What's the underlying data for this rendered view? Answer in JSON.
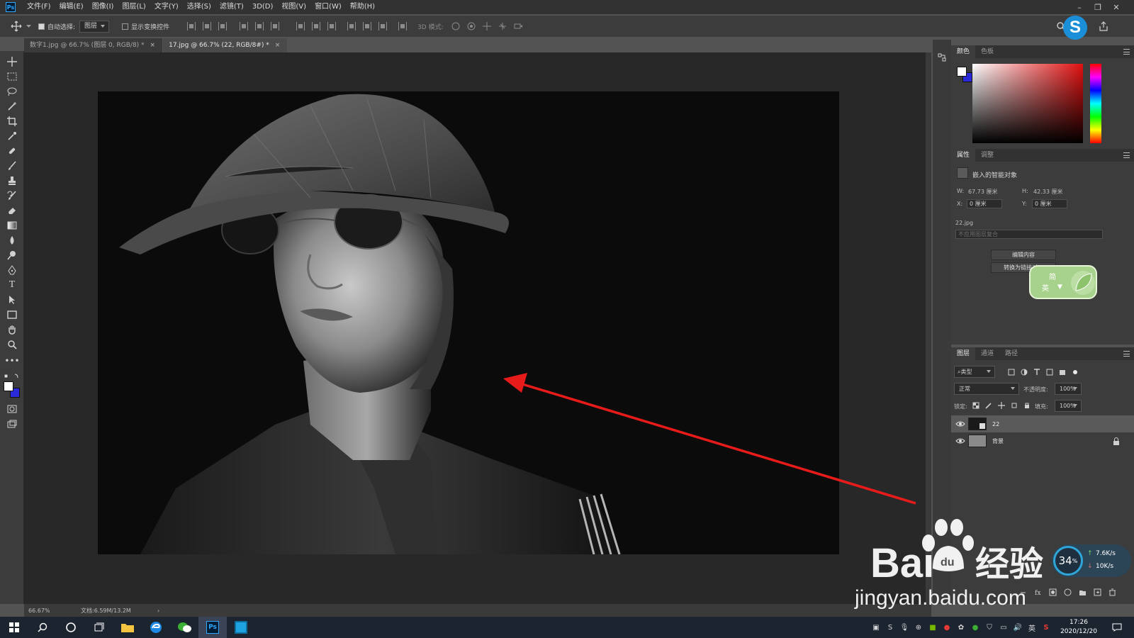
{
  "app": {
    "logo_text": "Ps",
    "menu": [
      "文件(F)",
      "编辑(E)",
      "图像(I)",
      "图层(L)",
      "文字(Y)",
      "选择(S)",
      "滤镜(T)",
      "3D(D)",
      "视图(V)",
      "窗口(W)",
      "帮助(H)"
    ],
    "window_controls": {
      "minimize": "–",
      "restore": "❐",
      "close": "✕"
    }
  },
  "options": {
    "auto_select_label": "自动选择:",
    "auto_select_checked": true,
    "auto_select_target": "图层",
    "show_transform_label": "显示变换控件",
    "show_transform_checked": false,
    "mode_3d_label": "3D 模式:"
  },
  "tabs": [
    {
      "label": "数字1.jpg @ 66.7% (图层 0, RGB/8) *",
      "active": false,
      "close": "×"
    },
    {
      "label": "17.jpg @ 66.7% (22, RGB/8#) *",
      "active": true,
      "close": "×"
    }
  ],
  "status": {
    "zoom": "66.67%",
    "doc_size": "文档:6.59M/13.2M",
    "arrow": "›"
  },
  "color_panel": {
    "tabs": [
      "颜色",
      "色板"
    ],
    "active_tab": "颜色",
    "foreground": "#ffffff",
    "background": "#2a2ad8"
  },
  "properties_panel": {
    "tabs": [
      "属性",
      "调整"
    ],
    "active_tab": "属性",
    "object_type": "嵌入的智能对象",
    "w_label": "W:",
    "w_value": "67.73 厘米",
    "h_label": "H:",
    "h_value": "42.33 厘米",
    "x_label": "X:",
    "x_value": "0 厘米",
    "y_label": "Y:",
    "y_value": "0 厘米",
    "source_file": "22.jpg",
    "layer_comp_placeholder": "不应用图层复合",
    "edit_contents_button": "编辑内容",
    "convert_linked_button": "转换为链接对..."
  },
  "ime_widget": {
    "line1": "简",
    "line2": "英"
  },
  "layers_panel": {
    "tabs": [
      "图层",
      "通道",
      "路径"
    ],
    "active_tab": "图层",
    "filter_kind": "类型",
    "blend_mode": "正常",
    "opacity_label": "不透明度:",
    "opacity_value": "100%",
    "lock_label": "锁定:",
    "fill_label": "填充:",
    "fill_value": "100%",
    "layers": [
      {
        "name": "22",
        "visible": true,
        "selected": true,
        "locked": false
      },
      {
        "name": "背景",
        "visible": true,
        "selected": false,
        "locked": true
      }
    ]
  },
  "network_widget": {
    "percent": "34",
    "unit": "%",
    "upload": "7.6K/s",
    "download": "10K/s"
  },
  "watermark": {
    "brand": "Bai",
    "brand_cn": "经验",
    "url": "jingyan.baidu.com"
  },
  "taskbar": {
    "tray_lang": "英",
    "time": "17:26",
    "date": "2020/12/20"
  },
  "colors": {
    "annotation_arrow": "#e81b1b",
    "ps_blue": "#31a8ff"
  }
}
